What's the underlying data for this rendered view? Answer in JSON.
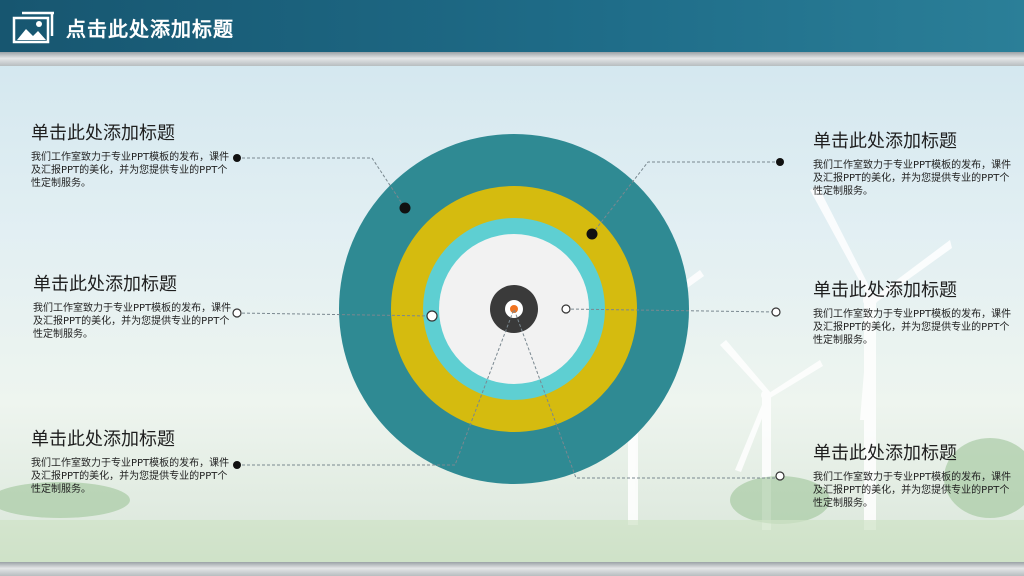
{
  "header": {
    "title": "点击此处添加标题"
  },
  "items": [
    {
      "title": "单击此处添加标题",
      "body": "我们工作室致力于专业PPT模板的发布，课件及汇报PPT的美化，并为您提供专业的PPT个性定制服务。"
    },
    {
      "title": "单击此处添加标题",
      "body": "我们工作室致力于专业PPT模板的发布，课件及汇报PPT的美化，并为您提供专业的PPT个性定制服务。"
    },
    {
      "title": "单击此处添加标题",
      "body": "我们工作室致力于专业PPT模板的发布，课件及汇报PPT的美化，并为您提供专业的PPT个性定制服务。"
    },
    {
      "title": "单击此处添加标题",
      "body": "我们工作室致力于专业PPT模板的发布，课件及汇报PPT的美化，并为您提供专业的PPT个性定制服务。"
    },
    {
      "title": "单击此处添加标题",
      "body": "我们工作室致力于专业PPT模板的发布，课件及汇报PPT的美化，并为您提供专业的PPT个性定制服务。"
    },
    {
      "title": "单击此处添加标题",
      "body": "我们工作室致力于专业PPT模板的发布，课件及汇报PPT的美化，并为您提供专业的PPT个性定制服务。"
    }
  ],
  "colors": {
    "outer_ring": "#2f8a93",
    "middle_ring": "#d5bb0f",
    "inner_ring": "#5ecfd2",
    "core": "#f2f2f2",
    "hub": "#3a3a3a",
    "hub_dot": "#f07320",
    "header": "#1c6582"
  }
}
